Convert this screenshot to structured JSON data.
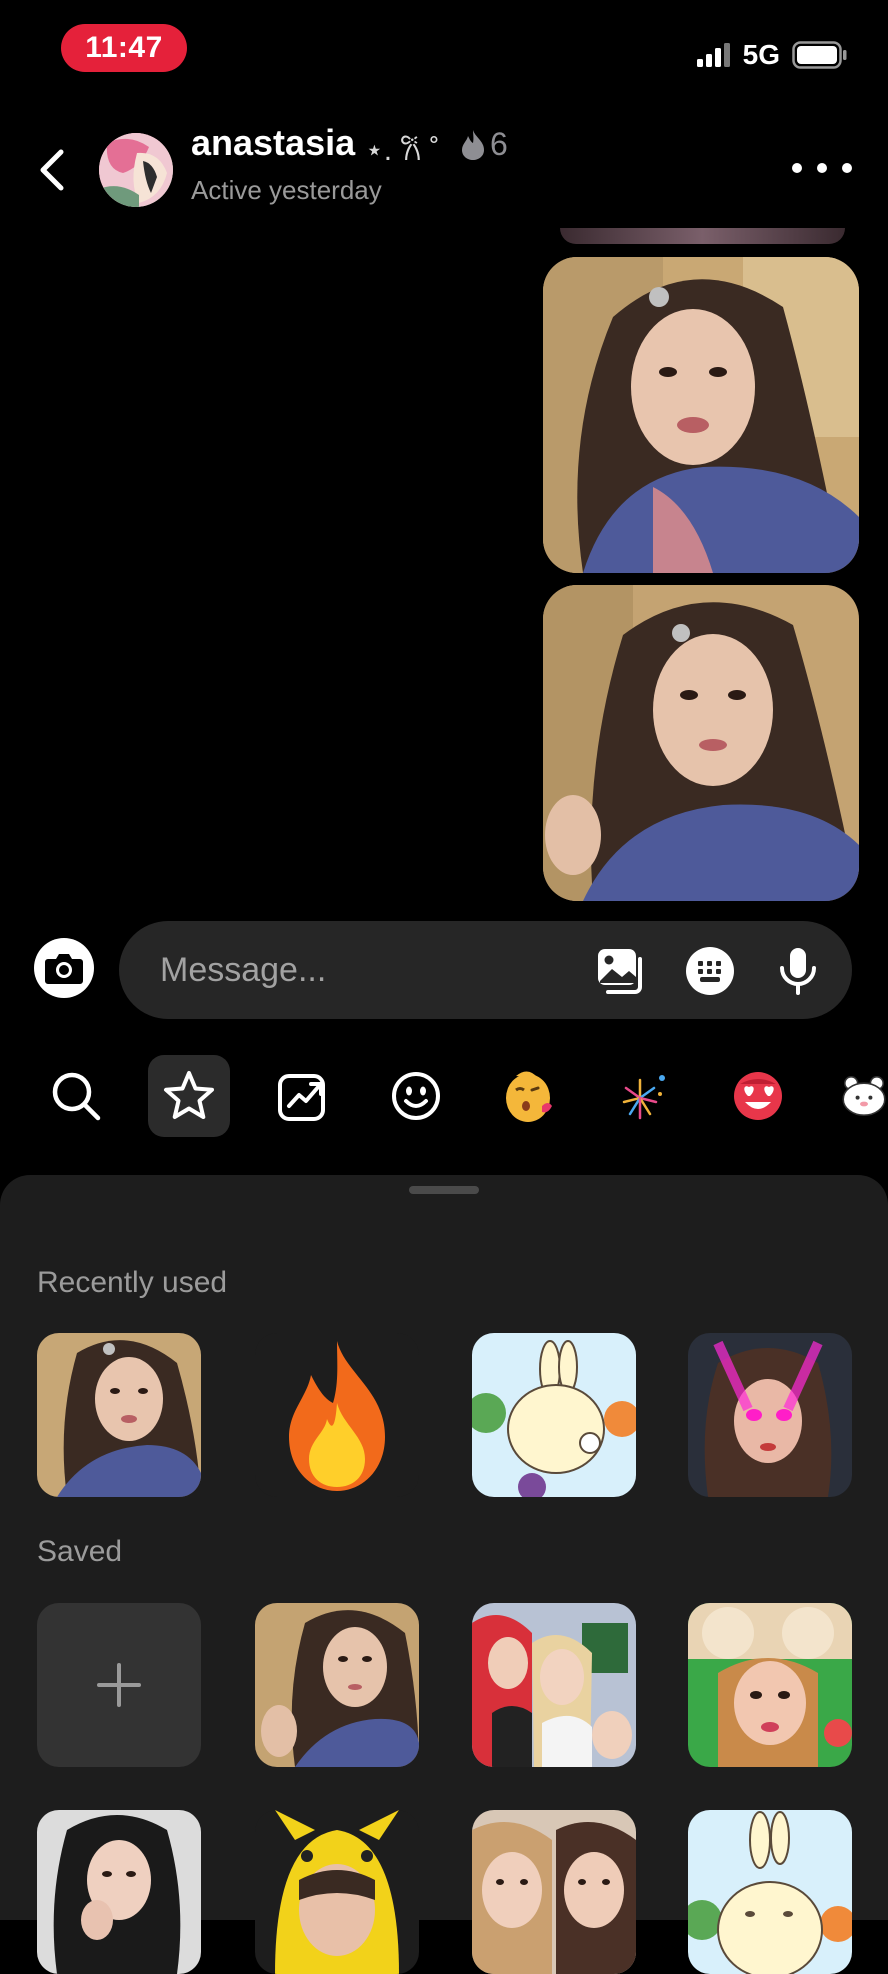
{
  "status_bar": {
    "time": "11:47",
    "network": "5G"
  },
  "header": {
    "contact_name": "anastasia",
    "flair": "⋆. 𐙚 ˚",
    "streak_count": "6",
    "active_status": "Active yesterday"
  },
  "composer": {
    "placeholder": "Message..."
  },
  "sticker_tabs": [
    {
      "icon": "search-icon"
    },
    {
      "icon": "star-icon",
      "selected": true
    },
    {
      "icon": "trending-icon"
    },
    {
      "icon": "smiley-icon"
    },
    {
      "icon": "kiss-emoji"
    },
    {
      "icon": "fireworks-emoji"
    },
    {
      "icon": "heart-eyes-emoji"
    },
    {
      "icon": "bear-sticker"
    }
  ],
  "sections": {
    "recent_label": "Recently used",
    "saved_label": "Saved"
  },
  "colors": {
    "time_pill": "#e5213a",
    "panel_bg": "#1d1d1d",
    "composer_bg": "#262626"
  }
}
